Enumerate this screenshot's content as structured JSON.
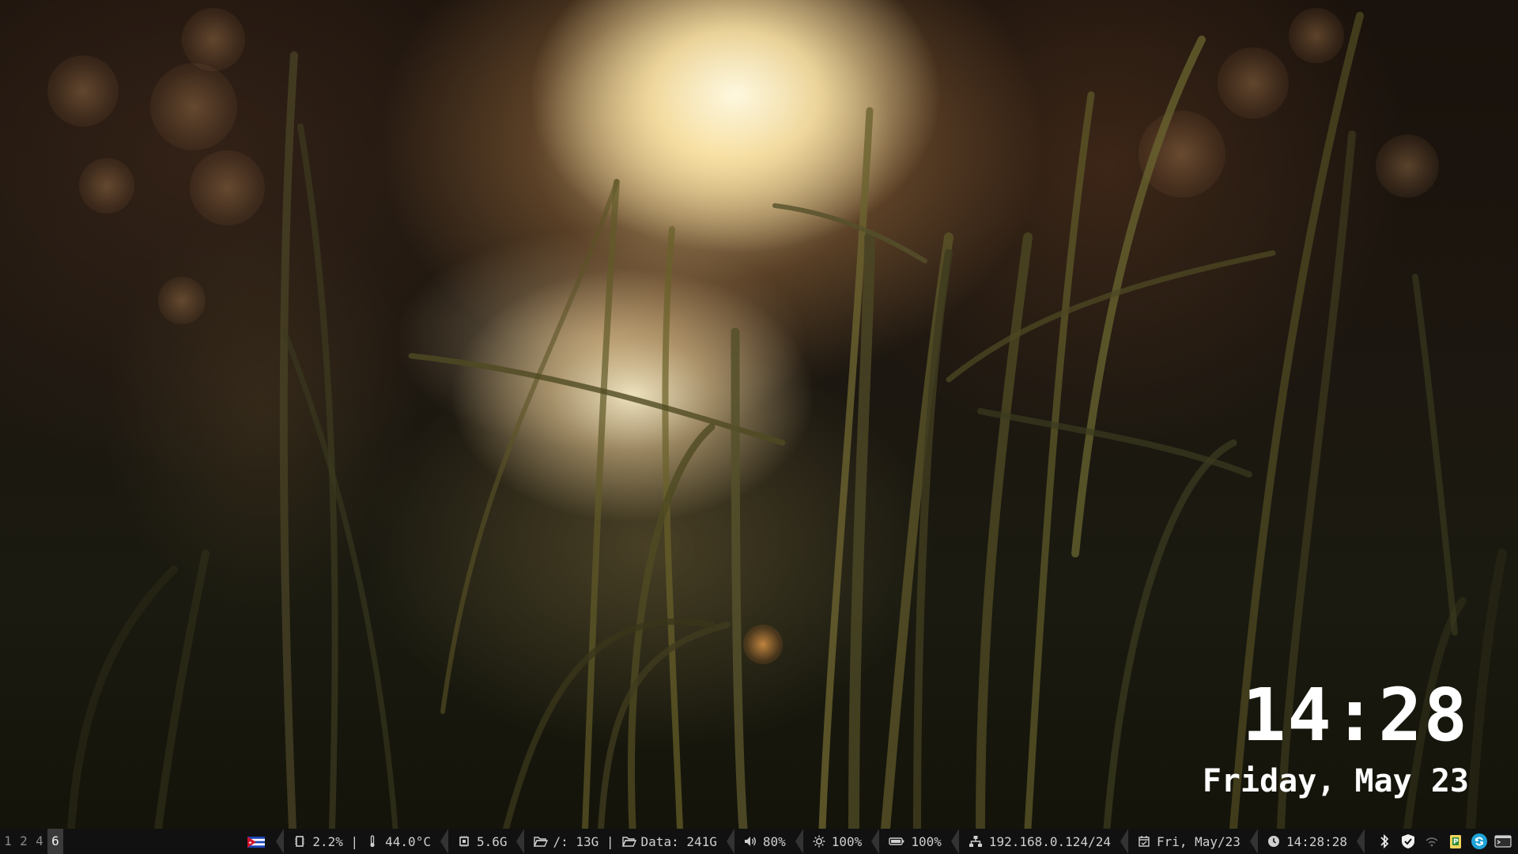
{
  "desktop": {
    "clock_time": "14:28",
    "clock_date": "Friday, May 23"
  },
  "workspaces": [
    {
      "label": "1",
      "active": false
    },
    {
      "label": "2",
      "active": false
    },
    {
      "label": "4",
      "active": false
    },
    {
      "label": "6",
      "active": true
    }
  ],
  "statusbar": {
    "keyboard_layout_icon": "flag-icon",
    "cpu_usage": "2.2% |",
    "cpu_temp": "44.0°C",
    "memory": "5.6G",
    "disk_root": "/: 13G |",
    "disk_data": "Data: 241G",
    "volume": "80%",
    "brightness": "100%",
    "battery": "100%",
    "network": "192.168.0.124/24",
    "date": "Fri, May/23",
    "time": "14:28:28"
  },
  "tray": [
    "bluetooth-icon",
    "vpn-shield-icon",
    "wifi-icon",
    "clipboard-icon",
    "sync-icon",
    "terminal-icon"
  ],
  "colors": {
    "bar_background": "#111111",
    "bar_text": "#cfcfcf",
    "active_workspace": "#3a3a3a",
    "clock_text": "#ffffff"
  }
}
